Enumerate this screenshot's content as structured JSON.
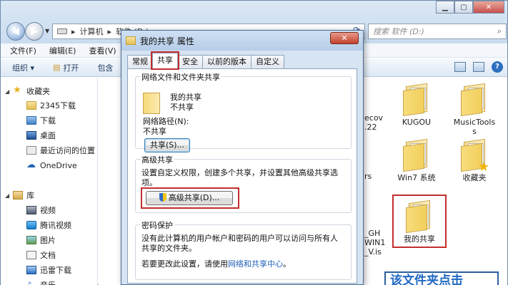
{
  "explorer": {
    "breadcrumb": [
      "计算机",
      "软件 (D:)"
    ],
    "search_placeholder": "搜索 软件 (D:)",
    "menu": [
      "文件(F)",
      "编辑(E)",
      "查看(V)"
    ],
    "toolbar": {
      "organize": "组织 ▾",
      "open": "打开",
      "include": "包含"
    },
    "sidebar": {
      "favorites": "收藏夹",
      "fav_items": [
        "2345下载",
        "下载",
        "桌面",
        "最近访问的位置"
      ],
      "onedrive": "OneDrive",
      "library": "库",
      "lib_items": [
        "视频",
        "腾讯视频",
        "图片",
        "文档",
        "迅雷下载",
        "音乐"
      ]
    },
    "files": [
      {
        "name": "KUGOU"
      },
      {
        "name": "MusicTools"
      },
      {
        "name": "Win7 系统"
      },
      {
        "name": "收藏夹"
      },
      {
        "name": "我的共享"
      }
    ],
    "partial_labels": {
      "a1": "ecov",
      "a2": ".22",
      "b1": "rs",
      "c1": "_GH",
      "c2": "WIN1",
      "c3": "_V.is",
      "musictools_wrap": "s"
    },
    "bottom_note": "该文件夹点击"
  },
  "dialog": {
    "title": "我的共享 属性",
    "close": "✕",
    "tabs": [
      "常规",
      "共享",
      "安全",
      "以前的版本",
      "自定义"
    ],
    "active_tab": "共享",
    "network": {
      "title": "网络文件和文件夹共享",
      "name": "我的共享",
      "state": "不共享",
      "path_label": "网络路径(N):",
      "path_value": "不共享",
      "share_button": "共享(S)..."
    },
    "advanced": {
      "title": "高级共享",
      "desc": "设置自定义权限，创建多个共享，并设置其他高级共享选项。",
      "button": "高级共享(D)..."
    },
    "password": {
      "title": "密码保护",
      "desc": "没有此计算机的用户帐户和密码的用户可以访问与所有人共享的文件夹。",
      "change_prefix": "若要更改此设置，请使用",
      "link": "网络和共享中心",
      "suffix": "。"
    }
  },
  "colors": {
    "highlight": "#c32d2d",
    "link": "#1f5fb8"
  }
}
